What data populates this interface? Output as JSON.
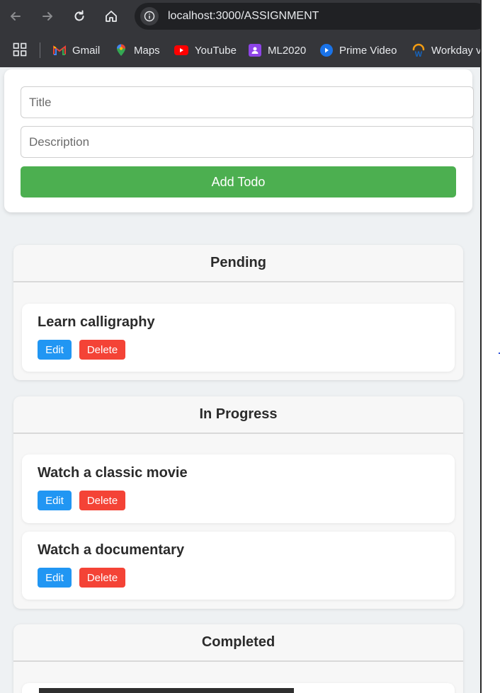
{
  "browser": {
    "url": "localhost:3000/ASSIGNMENT",
    "bookmarks": [
      {
        "label": "Gmail",
        "icon": "gmail-icon"
      },
      {
        "label": "Maps",
        "icon": "maps-icon"
      },
      {
        "label": "YouTube",
        "icon": "youtube-icon"
      },
      {
        "label": "ML2020",
        "icon": "ml2020-icon"
      },
      {
        "label": "Prime Video",
        "icon": "prime-video-icon"
      },
      {
        "label": "Workday v",
        "icon": "workday-icon"
      }
    ]
  },
  "form": {
    "title_placeholder": "Title",
    "description_placeholder": "Description",
    "add_label": "Add Todo"
  },
  "columns": {
    "pending": {
      "title": "Pending",
      "todos": [
        {
          "title": "Learn calligraphy"
        }
      ]
    },
    "in_progress": {
      "title": "In Progress",
      "todos": [
        {
          "title": "Watch a classic movie"
        },
        {
          "title": "Watch a documentary"
        }
      ]
    },
    "completed": {
      "title": "Completed",
      "todos": []
    }
  },
  "actions": {
    "edit_label": "Edit",
    "delete_label": "Delete"
  },
  "colors": {
    "add_button": "#4caf50",
    "edit_button": "#2196f3",
    "delete_button": "#f44336",
    "page_background": "#eef1f3",
    "browser_chrome": "#35363a"
  }
}
